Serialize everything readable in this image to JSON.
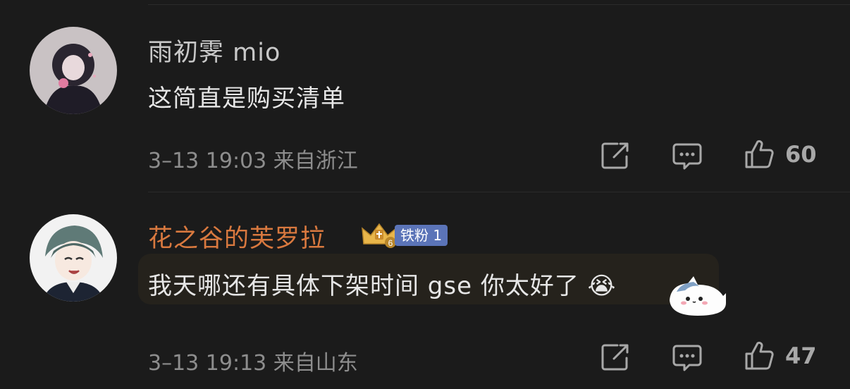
{
  "comments": [
    {
      "username": "雨初霁 mio",
      "text": "这简直是购买清单",
      "meta": "3–13 19:03 来自浙江",
      "likes": "60",
      "username_color": "#c8c8c8"
    },
    {
      "username": "花之谷的芙罗拉",
      "badge_level": "6",
      "badge_label": "铁粉 1",
      "text": "我天哪还有具体下架时间 gse 你太好了",
      "emoji": "😭",
      "meta": "3–13 19:13 来自山东",
      "likes": "47",
      "username_color": "#d9793f"
    }
  ],
  "icons": {
    "share": "share-icon",
    "comment": "comment-icon",
    "like": "like-icon",
    "sticker": "cat-sticker-icon"
  }
}
